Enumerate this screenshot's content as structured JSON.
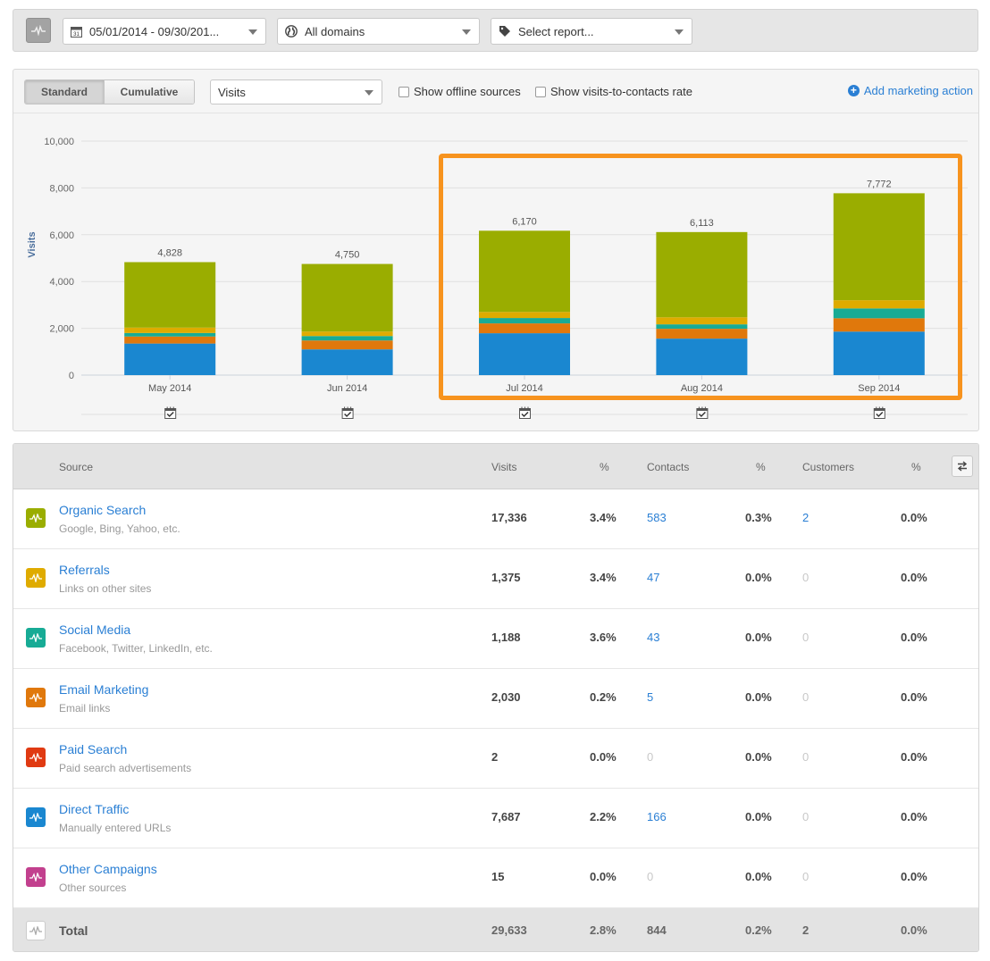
{
  "toolbar": {
    "date_range": "05/01/2014 - 09/30/201...",
    "domain_select": "All domains",
    "report_select": "Select report...",
    "icons": {
      "sources": "pulse-icon",
      "calendar": "calendar-icon",
      "globe": "globe-icon",
      "tag": "tag-icon"
    }
  },
  "chart_controls": {
    "standard_label": "Standard",
    "cumulative_label": "Cumulative",
    "active_view": "Standard",
    "metric_select": "Visits",
    "show_offline_label": "Show offline sources",
    "show_offline_checked": false,
    "show_rate_label": "Show visits-to-contacts rate",
    "show_rate_checked": false,
    "add_action_label": "Add marketing action"
  },
  "chart_data": {
    "type": "bar",
    "stacked": true,
    "title": "",
    "xlabel": "",
    "ylabel": "Visits",
    "ylim": [
      0,
      10000
    ],
    "yticks": [
      0,
      2000,
      4000,
      6000,
      8000,
      10000
    ],
    "ytick_labels": [
      "0",
      "2,000",
      "4,000",
      "6,000",
      "8,000",
      "10,000"
    ],
    "grid": true,
    "categories": [
      "May 2014",
      "Jun 2014",
      "Jul 2014",
      "Aug 2014",
      "Sep 2014"
    ],
    "totals": [
      4828,
      4750,
      6170,
      6113,
      7772
    ],
    "total_labels": [
      "4,828",
      "4,750",
      "6,170",
      "6,113",
      "7,772"
    ],
    "series": [
      {
        "name": "Direct Traffic",
        "color": "#1a87d0",
        "values": [
          1350,
          1100,
          1790,
          1560,
          1860
        ]
      },
      {
        "name": "Email Marketing",
        "color": "#e0780c",
        "values": [
          300,
          380,
          420,
          420,
          570
        ]
      },
      {
        "name": "Social Media",
        "color": "#17ab95",
        "values": [
          150,
          190,
          230,
          190,
          420
        ]
      },
      {
        "name": "Referrals",
        "color": "#dfab00",
        "values": [
          230,
          190,
          260,
          300,
          350
        ]
      },
      {
        "name": "Organic Search",
        "color": "#9aad00",
        "values": [
          2798,
          2890,
          3470,
          3643,
          4572
        ]
      }
    ],
    "annotations": [
      "Highlight box around Jul 2014 - Sep 2014"
    ],
    "marker_icon": "calendar-check-icon"
  },
  "table": {
    "headers": {
      "source": "Source",
      "visits": "Visits",
      "visits_pct": "%",
      "contacts": "Contacts",
      "contacts_pct": "%",
      "customers": "Customers",
      "customers_pct": "%"
    },
    "swap_icon": "swap-arrows-icon",
    "rows": [
      {
        "name": "Organic Search",
        "desc": "Google, Bing, Yahoo, etc.",
        "color": "#9aad00",
        "visits": "17,336",
        "visits_pct": "3.4%",
        "contacts": "583",
        "contacts_pct": "0.3%",
        "customers": "2",
        "customers_pct": "0.0%"
      },
      {
        "name": "Referrals",
        "desc": "Links on other sites",
        "color": "#dfab00",
        "visits": "1,375",
        "visits_pct": "3.4%",
        "contacts": "47",
        "contacts_pct": "0.0%",
        "customers": "0",
        "customers_pct": "0.0%"
      },
      {
        "name": "Social Media",
        "desc": "Facebook, Twitter, LinkedIn, etc.",
        "color": "#17ab95",
        "visits": "1,188",
        "visits_pct": "3.6%",
        "contacts": "43",
        "contacts_pct": "0.0%",
        "customers": "0",
        "customers_pct": "0.0%"
      },
      {
        "name": "Email Marketing",
        "desc": "Email links",
        "color": "#e0780c",
        "visits": "2,030",
        "visits_pct": "0.2%",
        "contacts": "5",
        "contacts_pct": "0.0%",
        "customers": "0",
        "customers_pct": "0.0%"
      },
      {
        "name": "Paid Search",
        "desc": "Paid search advertisements",
        "color": "#e03a12",
        "visits": "2",
        "visits_pct": "0.0%",
        "contacts": "0",
        "contacts_pct": "0.0%",
        "customers": "0",
        "customers_pct": "0.0%"
      },
      {
        "name": "Direct Traffic",
        "desc": "Manually entered URLs",
        "color": "#1a87d0",
        "visits": "7,687",
        "visits_pct": "2.2%",
        "contacts": "166",
        "contacts_pct": "0.0%",
        "customers": "0",
        "customers_pct": "0.0%"
      },
      {
        "name": "Other Campaigns",
        "desc": "Other sources",
        "color": "#c2408e",
        "visits": "15",
        "visits_pct": "0.0%",
        "contacts": "0",
        "contacts_pct": "0.0%",
        "customers": "0",
        "customers_pct": "0.0%"
      }
    ],
    "total": {
      "name": "Total",
      "visits": "29,633",
      "visits_pct": "2.8%",
      "contacts": "844",
      "contacts_pct": "0.2%",
      "customers": "2",
      "customers_pct": "0.0%"
    }
  }
}
